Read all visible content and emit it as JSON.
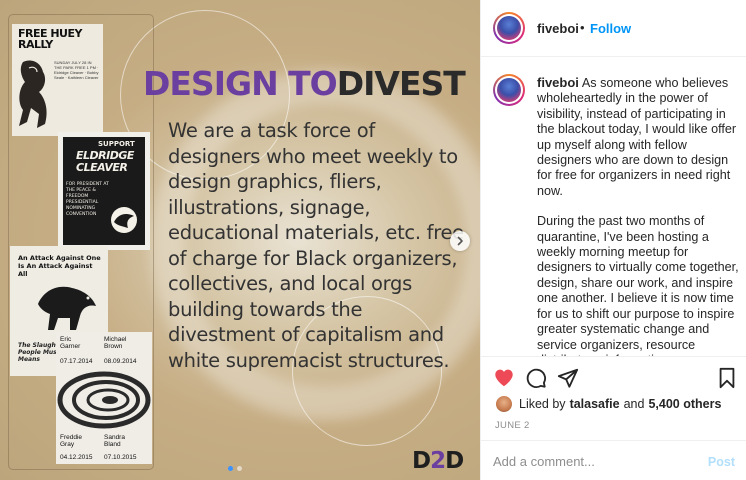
{
  "post_image": {
    "headline_part1": "DESIGN TO",
    "headline_part2": "DIVEST",
    "body": "We are a task force of designers who meet weekly to design graphics, fliers, illustrations, signage, educational materials, etc. free of charge for Black organizers, collectives, and local orgs building towards the divestment of capitalism and white supremacist structures.",
    "logo_d1": "D",
    "logo_two": "2",
    "logo_d2": "D",
    "posters": {
      "p1_title": "FREE HUEY RALLY",
      "p1_text": "SUNDAY JULY 28 IN THE PARK FREE 1 PM · Eldridge Cleaver · Bobby Seale · Kathleen Cleaver",
      "p2_support": "SUPPORT",
      "p2_name": "ELDRIDGE CLEAVER",
      "p2_text": "FOR PRESIDENT AT THE PEACE & FREEDOM PRESIDENTIAL NOMINATING CONVENTION",
      "p3_title": "An Attack Against One Is An Attack Against All",
      "p3_footer": "The Slaughter of Black People Must Stop By Any Means",
      "p4_name1": "Eric Garner",
      "p4_date1": "07.17.2014",
      "p4_name2": "Michael Brown",
      "p4_date2": "08.09.2014",
      "p4_name3": "Freddie Gray",
      "p4_date3": "04.12.2015",
      "p4_name4": "Sandra Bland",
      "p4_date4": "07.10.2015"
    },
    "carousel": {
      "count": 2,
      "active_index": 0
    }
  },
  "header": {
    "username": "fiveboi",
    "separator": "•",
    "follow_label": "Follow"
  },
  "caption": {
    "username": "fiveboi",
    "paragraph1": "As someone who believes wholeheartedly in the power of visibility, instead of participating in the blackout today, I would like offer up myself along with fellow designers who are down to design for free for organizers in need right now.",
    "paragraph2": "During the past two months of quarantine, I've been hosting a weekly morning meetup for designers to virtually come together, design, share our work, and inspire one another. I believe it is now time for us to shift our purpose to inspire greater systematic change and service organizers, resource distributors, information disseminators, and movement builders in need of design work. Rise & Design"
  },
  "actions": {
    "like_icon": "heart-icon",
    "comment_icon": "comment-icon",
    "share_icon": "paper-plane-icon",
    "save_icon": "bookmark-icon",
    "like_color": "#ed4956"
  },
  "likes": {
    "prefix": "Liked by",
    "user": "talasafie",
    "conjunction": "and",
    "others": "5,400 others"
  },
  "date": "JUNE 2",
  "add_comment": {
    "placeholder": "Add a comment...",
    "post_label": "Post"
  }
}
